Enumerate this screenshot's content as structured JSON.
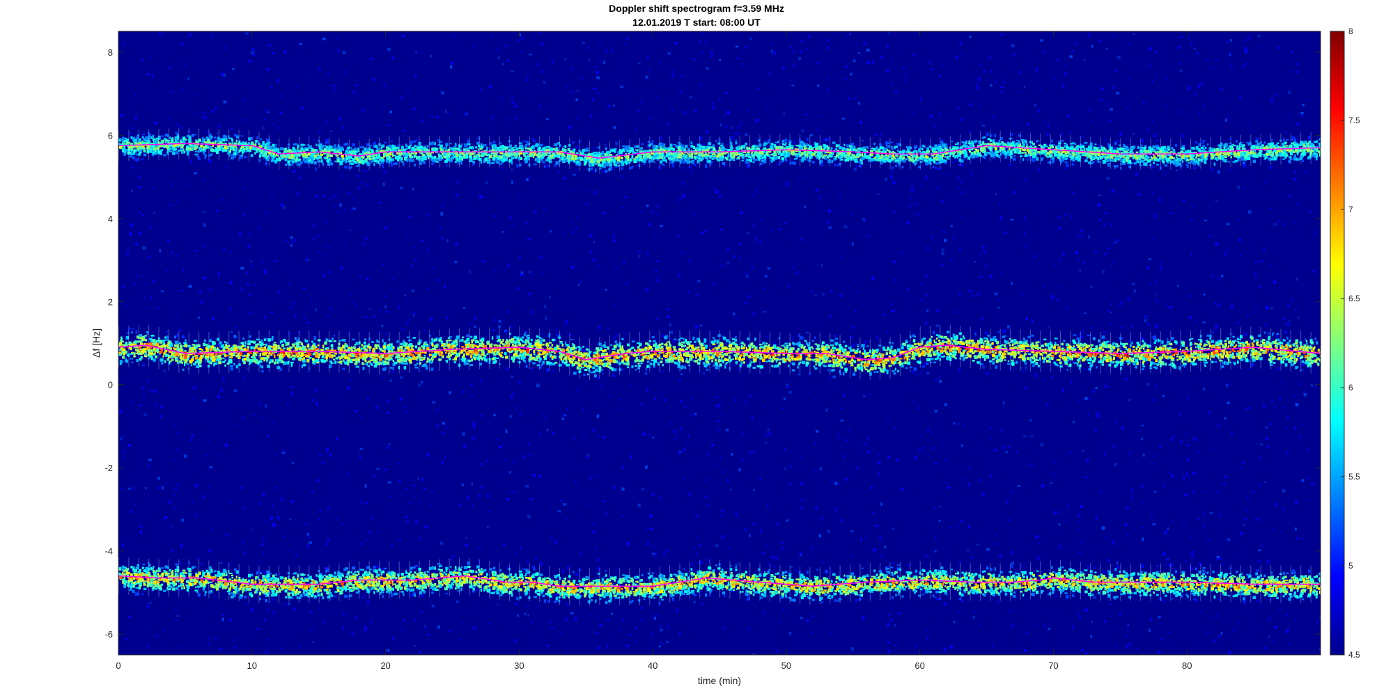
{
  "chart_data": {
    "type": "heatmap",
    "title": "Doppler shift spectrogram f=3.59 MHz",
    "subtitle": "12.01.2019   T start: 08:00 UT",
    "xlabel": "time (min)",
    "ylabel": "Δf [Hz]",
    "xlim": [
      0,
      90
    ],
    "ylim": [
      -6.5,
      8.5
    ],
    "x_ticks": [
      0,
      10,
      20,
      30,
      40,
      50,
      60,
      70,
      80
    ],
    "y_ticks": [
      -6,
      -4,
      -2,
      0,
      2,
      4,
      6,
      8
    ],
    "colormap": "jet",
    "colorbar": {
      "limits": [
        4.5,
        8
      ],
      "ticks": [
        "4.5",
        "5",
        "5.5",
        "6",
        "6.5",
        "7",
        "7.5",
        "8"
      ]
    },
    "background_color": "#00008f",
    "trace_color": "#ff00ff",
    "series": [
      {
        "x": [
          0,
          5,
          10,
          12,
          15,
          18,
          20,
          25,
          30,
          33,
          36,
          40,
          45,
          50,
          55,
          58,
          61,
          65,
          70,
          75,
          80,
          85,
          90
        ],
        "y": [
          5.75,
          5.8,
          5.75,
          5.55,
          5.6,
          5.5,
          5.6,
          5.6,
          5.6,
          5.6,
          5.45,
          5.6,
          5.6,
          5.65,
          5.6,
          5.55,
          5.55,
          5.75,
          5.65,
          5.55,
          5.55,
          5.65,
          5.7
        ]
      },
      {
        "x": [
          0,
          2,
          5,
          10,
          15,
          20,
          25,
          30,
          33,
          35,
          38,
          40,
          45,
          50,
          53,
          56,
          58,
          60,
          62,
          65,
          70,
          75,
          80,
          85,
          90
        ],
        "y": [
          0.9,
          0.95,
          0.75,
          0.8,
          0.8,
          0.75,
          0.85,
          0.9,
          0.8,
          0.6,
          0.75,
          0.8,
          0.8,
          0.75,
          0.75,
          0.6,
          0.65,
          0.9,
          0.95,
          0.85,
          0.8,
          0.75,
          0.8,
          0.9,
          0.75
        ]
      },
      {
        "x": [
          0,
          3,
          6,
          10,
          15,
          18,
          22,
          26,
          29,
          31,
          33,
          36,
          40,
          44,
          48,
          52,
          56,
          60,
          64,
          67,
          69,
          70,
          73,
          76,
          80,
          85,
          90
        ],
        "y": [
          -4.6,
          -4.65,
          -4.65,
          -4.8,
          -4.8,
          -4.7,
          -4.7,
          -4.6,
          -4.75,
          -4.75,
          -4.85,
          -4.85,
          -4.85,
          -4.65,
          -4.75,
          -4.85,
          -4.75,
          -4.7,
          -4.75,
          -4.75,
          -4.7,
          -4.65,
          -4.75,
          -4.75,
          -4.75,
          -4.8,
          -4.8
        ]
      }
    ]
  }
}
